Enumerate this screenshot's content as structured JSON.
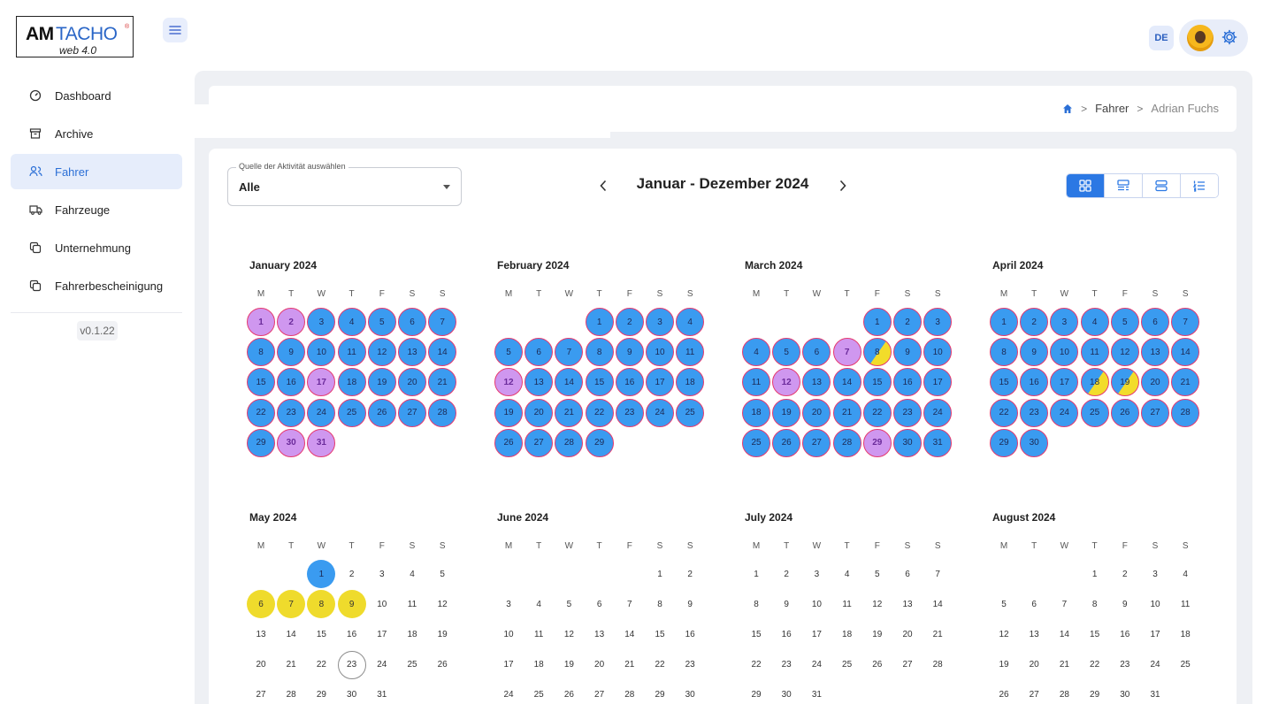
{
  "app": {
    "logo": {
      "brand_bold": "AM",
      "brand_light": "TACHO",
      "sub": "web 4.0"
    },
    "version": "v0.1.22",
    "language": "DE"
  },
  "sidebar": {
    "items": [
      {
        "label": "Dashboard",
        "icon": "dashboard-icon"
      },
      {
        "label": "Archive",
        "icon": "archive-icon"
      },
      {
        "label": "Fahrer",
        "icon": "users-icon",
        "active": true
      },
      {
        "label": "Fahrzeuge",
        "icon": "truck-icon"
      },
      {
        "label": "Unternehmung",
        "icon": "company-icon"
      },
      {
        "label": "Fahrerbescheinigung",
        "icon": "certificate-icon"
      }
    ]
  },
  "breadcrumb": {
    "section": "Fahrer",
    "current": "Adrian Fuchs"
  },
  "filter": {
    "label": "Quelle der Aktivität auswählen",
    "value": "Alle"
  },
  "period": {
    "label": "Januar - Dezember 2024"
  },
  "colors": {
    "blue": "#3a9bf0",
    "purple": "#cf97ef",
    "yellow": "#efdb2c",
    "ring": "#e63a6f",
    "accent": "#2b78e4"
  },
  "calendar": {
    "weekdays": [
      "M",
      "T",
      "W",
      "T",
      "F",
      "S",
      "S"
    ],
    "months": [
      {
        "name": "January 2024",
        "first_dow": 0,
        "days": 31,
        "states": {
          "1": "purple",
          "2": "purple",
          "17": "purple",
          "30": "purple",
          "31": "purple"
        },
        "default": "blue"
      },
      {
        "name": "February 2024",
        "first_dow": 3,
        "days": 29,
        "states": {
          "12": "purple"
        },
        "default": "blue"
      },
      {
        "name": "March 2024",
        "first_dow": 4,
        "days": 31,
        "states": {
          "7": "purple",
          "8": "split",
          "12": "purple",
          "29": "purple"
        },
        "default": "blue"
      },
      {
        "name": "April 2024",
        "first_dow": 0,
        "days": 30,
        "states": {
          "18": "split",
          "19": "split"
        },
        "default": "blue"
      },
      {
        "name": "May 2024",
        "first_dow": 2,
        "days": 31,
        "states": {
          "1": "solidblue",
          "6": "yellow",
          "7": "yellow",
          "8": "yellow",
          "9": "yellow",
          "23": "today"
        },
        "default": "plain"
      },
      {
        "name": "June 2024",
        "first_dow": 5,
        "days": 30,
        "states": {},
        "default": "plain"
      },
      {
        "name": "July 2024",
        "first_dow": 0,
        "days": 31,
        "states": {},
        "default": "plain"
      },
      {
        "name": "August 2024",
        "first_dow": 3,
        "days": 31,
        "states": {},
        "default": "plain"
      }
    ]
  }
}
